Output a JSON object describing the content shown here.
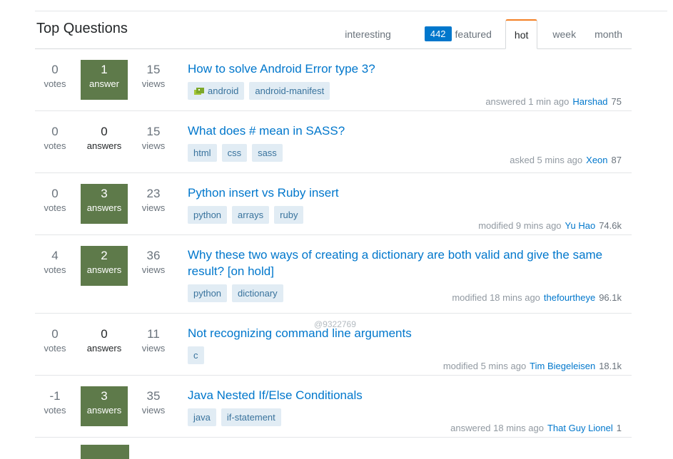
{
  "page": {
    "title": "Top Questions"
  },
  "tabs": {
    "interesting": "interesting",
    "featured_count": "442",
    "featured": "featured",
    "hot": "hot",
    "week": "week",
    "month": "month"
  },
  "questions": [
    {
      "votes": "0",
      "votes_label": "votes",
      "answers": "1",
      "answers_label": "answer",
      "has_answers": true,
      "views": "15",
      "views_label": "views",
      "title": "How to solve Android Error type 3?",
      "tags": [
        "android",
        "android-manifest"
      ],
      "action": "answered 1 min ago",
      "user": "Harshad",
      "rep": "75"
    },
    {
      "votes": "0",
      "votes_label": "votes",
      "answers": "0",
      "answers_label": "answers",
      "has_answers": false,
      "views": "15",
      "views_label": "views",
      "title": "What does # mean in SASS?",
      "tags": [
        "html",
        "css",
        "sass"
      ],
      "action": "asked 5 mins ago",
      "user": "Xeon",
      "rep": "87"
    },
    {
      "votes": "0",
      "votes_label": "votes",
      "answers": "3",
      "answers_label": "answers",
      "has_answers": true,
      "views": "23",
      "views_label": "views",
      "title": "Python insert vs Ruby insert",
      "tags": [
        "python",
        "arrays",
        "ruby"
      ],
      "action": "modified 9 mins ago",
      "user": "Yu Hao",
      "rep": "74.6k"
    },
    {
      "votes": "4",
      "votes_label": "votes",
      "answers": "2",
      "answers_label": "answers",
      "has_answers": true,
      "views": "36",
      "views_label": "views",
      "title": "Why these two ways of creating a dictionary are both valid and give the same result? [on hold]",
      "tags": [
        "python",
        "dictionary"
      ],
      "action": "modified 18 mins ago",
      "user": "thefourtheye",
      "rep": "96.1k"
    },
    {
      "votes": "0",
      "votes_label": "votes",
      "answers": "0",
      "answers_label": "answers",
      "has_answers": false,
      "views": "11",
      "views_label": "views",
      "title": "Not recognizing command line arguments",
      "tags": [
        "c"
      ],
      "action": "modified 5 mins ago",
      "user": "Tim Biegeleisen",
      "rep": "18.1k"
    },
    {
      "votes": "-1",
      "votes_label": "votes",
      "answers": "3",
      "answers_label": "answers",
      "has_answers": true,
      "views": "35",
      "views_label": "views",
      "title": "Java Nested If/Else Conditionals",
      "tags": [
        "java",
        "if-statement"
      ],
      "action": "answered 18 mins ago",
      "user": "That Guy Lionel",
      "rep": "1"
    }
  ],
  "watermark": "@9322769",
  "colors": {
    "link": "#0077cc",
    "answered": "#5e7a4a",
    "tag_bg": "#e1ecf4",
    "tag_text": "#39739d",
    "active_tab": "#f48024"
  }
}
